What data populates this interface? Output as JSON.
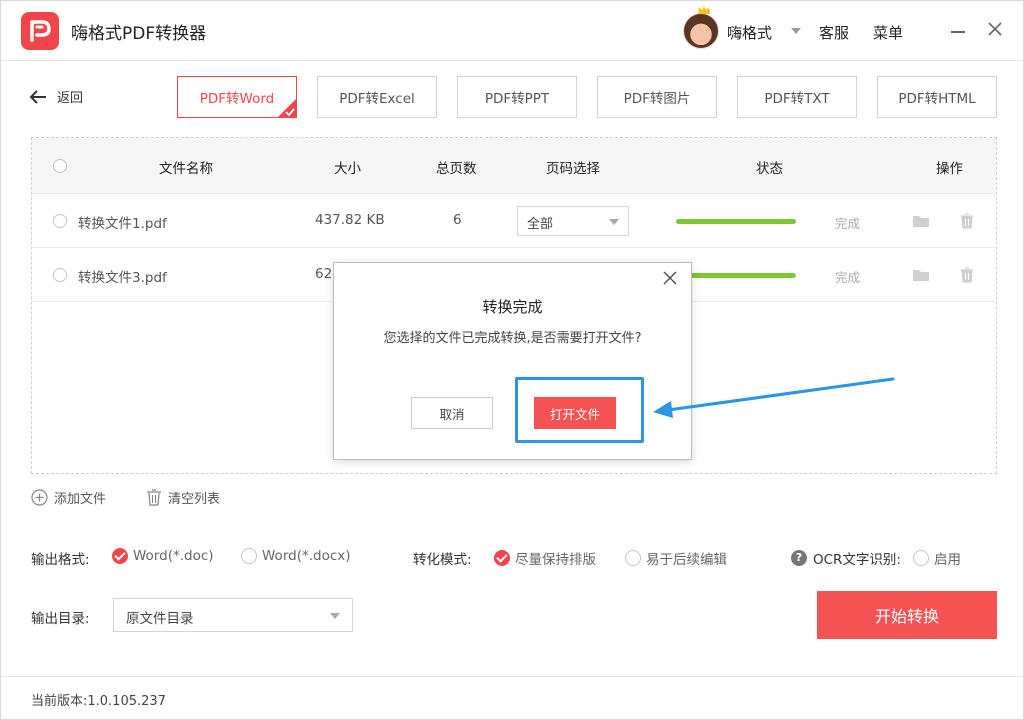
{
  "app": {
    "title": "嗨格式PDF转换器",
    "user_name": "嗨格式",
    "service_label": "客服",
    "menu_label": "菜单"
  },
  "toolbar": {
    "back_label": "返回",
    "tabs": [
      {
        "label": "PDF转Word",
        "active": true
      },
      {
        "label": "PDF转Excel",
        "active": false
      },
      {
        "label": "PDF转PPT",
        "active": false
      },
      {
        "label": "PDF转图片",
        "active": false
      },
      {
        "label": "PDF转TXT",
        "active": false
      },
      {
        "label": "PDF转HTML",
        "active": false
      }
    ]
  },
  "table": {
    "headers": {
      "name": "文件名称",
      "size": "大小",
      "pages": "总页数",
      "page_select": "页码选择",
      "status": "状态",
      "actions": "操作"
    },
    "rows": [
      {
        "name": "转换文件1.pdf",
        "size": "437.82 KB",
        "pages": "6",
        "page_select": "全部",
        "status": "完成"
      },
      {
        "name": "转换文件3.pdf",
        "size": "62",
        "pages": "",
        "page_select": "",
        "status": "完成"
      }
    ]
  },
  "panel_actions": {
    "add_label": "添加文件",
    "clear_label": "清空列表"
  },
  "options": {
    "format_label": "输出格式:",
    "format_doc": "Word(*.doc)",
    "format_docx": "Word(*.docx)",
    "mode_label": "转化模式:",
    "mode_keep": "尽量保持排版",
    "mode_edit": "易于后续编辑",
    "ocr_label": "OCR文字识别:",
    "ocr_enable": "启用",
    "help_glyph": "?"
  },
  "output": {
    "dir_label": "输出目录:",
    "dir_value": "原文件目录",
    "start_label": "开始转换"
  },
  "footer": {
    "version": "当前版本:1.0.105.237"
  },
  "modal": {
    "title": "转换完成",
    "message": "您选择的文件已完成转换,是否需要打开文件?",
    "cancel_label": "取消",
    "open_label": "打开文件"
  },
  "colors": {
    "accent": "#f0464b",
    "progress": "#7cc82d",
    "highlight": "#2b95e8"
  }
}
